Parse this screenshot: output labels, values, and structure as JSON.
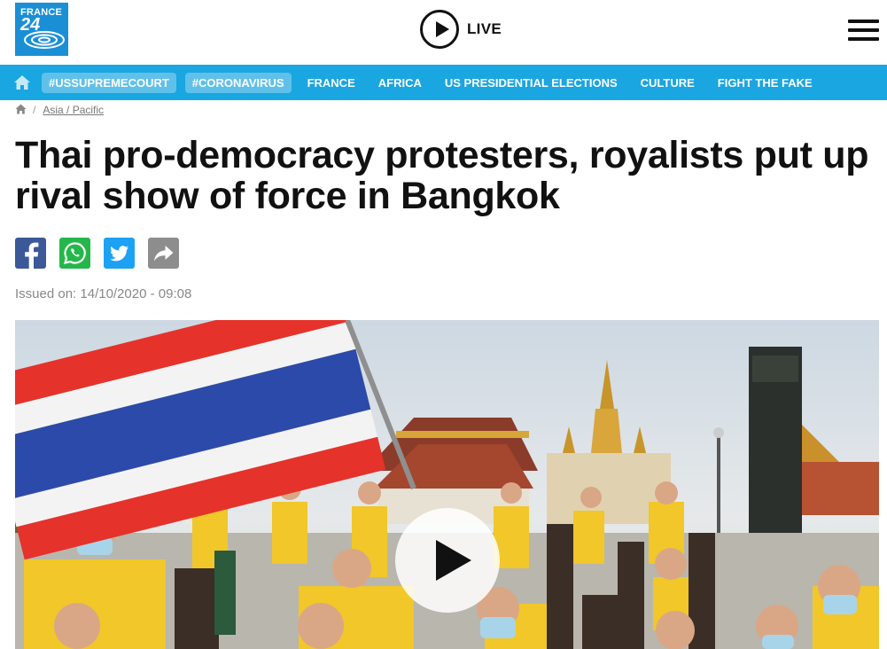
{
  "logo": {
    "line1": "FRANCE",
    "line2": "24"
  },
  "header": {
    "live_label": "LIVE"
  },
  "nav": {
    "tags": [
      "#USSUPREMECOURT",
      "#CORONAVIRUS"
    ],
    "items": [
      "FRANCE",
      "AFRICA",
      "US PRESIDENTIAL ELECTIONS",
      "CULTURE",
      "FIGHT THE FAKE"
    ]
  },
  "breadcrumb": {
    "separator": "/",
    "section": "Asia / Pacific"
  },
  "article": {
    "title": "Thai pro-democracy protesters, royalists put up rival show of force in Bangkok",
    "issued": "Issued on: 14/10/2020 - 09:08"
  },
  "colors": {
    "brand": "#1aa6e0",
    "facebook": "#3b5998",
    "whatsapp": "#25b74a",
    "twitter": "#1da1f2",
    "share": "#8d8d8d"
  }
}
